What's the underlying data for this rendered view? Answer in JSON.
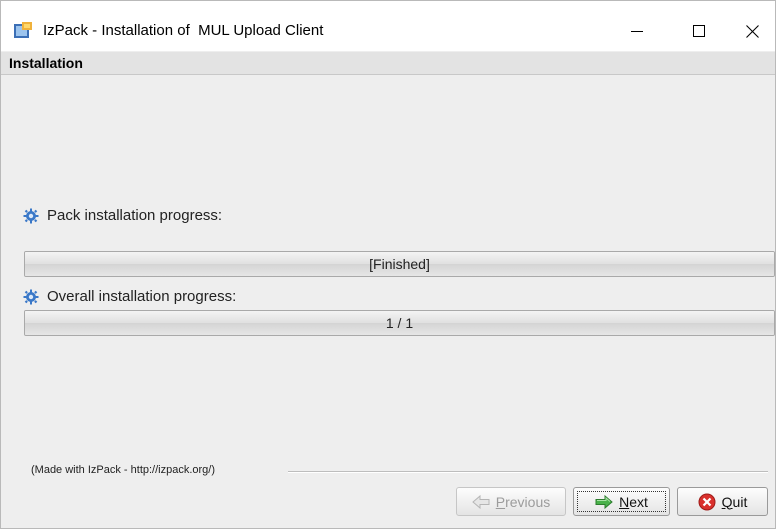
{
  "window": {
    "title": "IzPack - Installation of  MUL Upload Client",
    "controls": {
      "minimize_icon": "minimize-icon",
      "maximize_icon": "maximize-icon",
      "close_icon": "close-icon"
    }
  },
  "header": {
    "title": "Installation"
  },
  "progress": {
    "pack": {
      "label": "Pack installation progress:",
      "value_text": "[Finished]",
      "fraction": 1.0
    },
    "overall": {
      "label": "Overall installation progress:",
      "value_text": "1 / 1",
      "fraction": 1.0
    }
  },
  "footer": {
    "made_with": "(Made with IzPack - http://izpack.org/)",
    "buttons": {
      "previous": "Previous",
      "next": "Next",
      "quit": "Quit"
    }
  },
  "colors": {
    "window_bg": "#eeeeee",
    "next_arrow": "#3aa53a",
    "quit_red": "#d9302c"
  }
}
